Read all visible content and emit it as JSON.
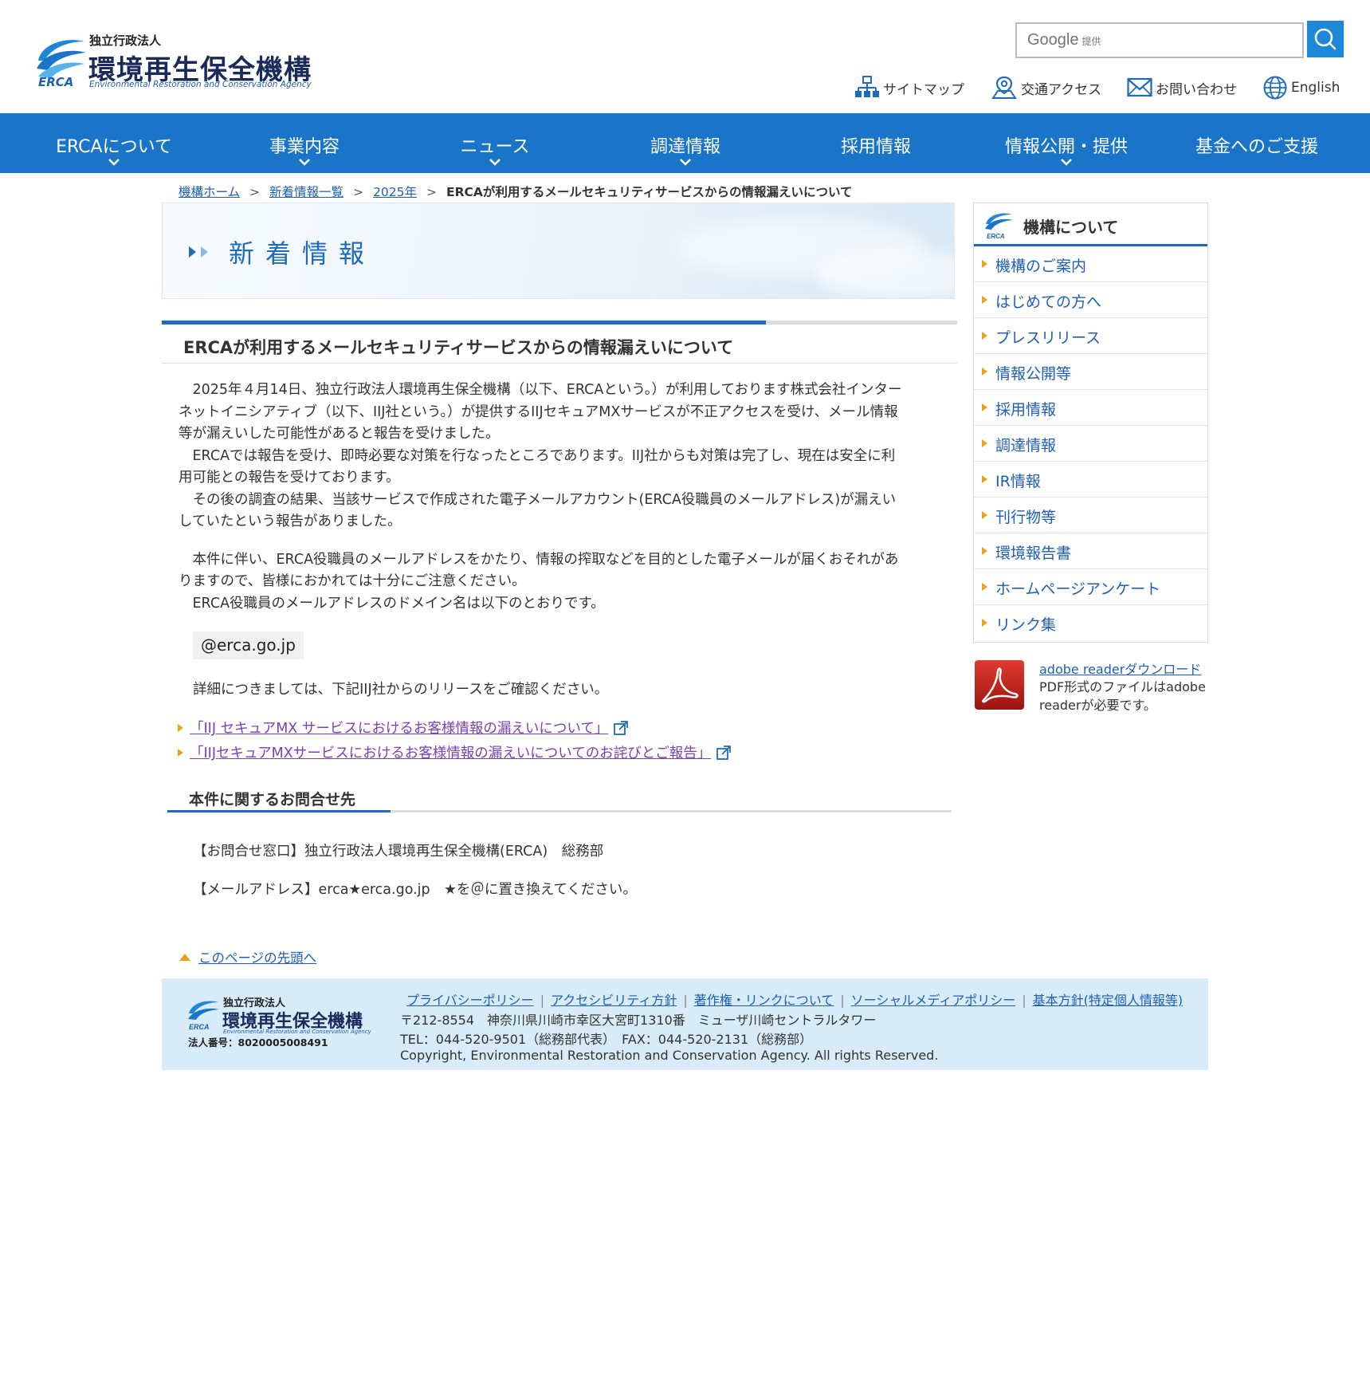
{
  "header": {
    "logo": {
      "small": "独立行政法人",
      "main": "環境再生保全機構",
      "en": "Environmental Restoration and Conservation Agency",
      "mark_text": "ERCA"
    },
    "search": {
      "brand": "Google",
      "brand_suffix": "提供",
      "placeholder": ""
    },
    "util_links": [
      {
        "label": "サイトマップ",
        "icon": "sitemap-icon"
      },
      {
        "label": "交通アクセス",
        "icon": "map-pin-icon"
      },
      {
        "label": "お問い合わせ",
        "icon": "mail-icon"
      },
      {
        "label": "English",
        "icon": "globe-icon"
      }
    ]
  },
  "nav": [
    {
      "label": "ERCAについて",
      "has_dropdown": true
    },
    {
      "label": "事業内容",
      "has_dropdown": true
    },
    {
      "label": "ニュース",
      "has_dropdown": true
    },
    {
      "label": "調達情報",
      "has_dropdown": true
    },
    {
      "label": "採用情報",
      "has_dropdown": false
    },
    {
      "label": "情報公開・提供",
      "has_dropdown": true
    },
    {
      "label": "基金へのご支援",
      "has_dropdown": false
    }
  ],
  "breadcrumb": {
    "items": [
      "機構ホーム",
      "新着情報一覧",
      "2025年"
    ],
    "separator": ">",
    "current": "ERCAが利用するメールセキュリティサービスからの情報漏えいについて"
  },
  "banner": {
    "title": "新着情報"
  },
  "article": {
    "title": "ERCAが利用するメールセキュリティサービスからの情報漏えいについて",
    "lines": [
      "　2025年４月14日、独立行政法人環境再生保全機構（以下、ERCAという。）が利用しております株式会社インター",
      "ネットイニシアティブ（以下、IIJ社という。）が提供するIIJセキュアMXサービスが不正アクセスを受け、メール情報",
      "等が漏えいした可能性があると報告を受けました。",
      "　ERCAでは報告を受け、即時必要な対策を行なったところであります。IIJ社からも対策は完了し、現在は安全に利",
      "用可能との報告を受けております。",
      "　その後の調査の結果、当該サービスで作成された電子メールアカウント(ERCA役職員のメールアドレス)が漏えい",
      "していたという報告がありました。"
    ],
    "lines2": [
      "　本件に伴い、ERCA役職員のメールアドレスをかたり、情報の搾取などを目的とした電子メールが届くおそれがあ",
      "りますので、皆様におかれては十分にご注意ください。",
      "　ERCA役職員のメールアドレスのドメイン名は以下のとおりです。"
    ],
    "domain": "@erca.go.jp",
    "details": "詳細につきましては、下記IIJ社からのリリースをご確認ください。",
    "links": [
      "「IIJ セキュアMX サービスにおけるお客様情報の漏えいについて」",
      "「IIJセキュアMXサービスにおけるお客様情報の漏えいについてのお詫びとご報告」"
    ]
  },
  "contact": {
    "title": "本件に関するお問合せ先",
    "window": "【お問合せ窓口】独立行政法人環境再生保全機構(ERCA)　総務部",
    "mail": "【メールアドレス】erca★erca.go.jp　★を＠に置き換えてください。"
  },
  "to_top": "このページの先頭へ",
  "sidebar": {
    "title": "機構について",
    "items": [
      "機構のご案内",
      "はじめての方へ",
      "プレスリリース",
      "情報公開等",
      "採用情報",
      "調達情報",
      "IR情報",
      "刊行物等",
      "環境報告書",
      "ホームページアンケート",
      "リンク集"
    ],
    "adobe": {
      "link": "adobe readerダウンロード",
      "note": "PDF形式のファイルはadobe readerが必要です。"
    }
  },
  "footer": {
    "logo": {
      "small": "独立行政法人",
      "main": "環境再生保全機構",
      "en": "Environmental Restoration and Conservation Agency",
      "corp_no": "法人番号：8020005008491",
      "mark_text": "ERCA"
    },
    "links": [
      "プライバシーポリシー",
      "アクセシビリティ方針",
      "著作権・リンクについて",
      "ソーシャルメディアポリシー",
      "基本方針(特定個人情報等)"
    ],
    "address": "〒212-8554　神奈川県川崎市幸区大宮町1310番　ミューザ川崎セントラルタワー",
    "tel": "TEL：044-520-9501（総務部代表）　FAX：044-520-2131（総務部）",
    "copyright": "Copyright, Environmental Restoration and Conservation Agency. All rights Reserved."
  },
  "colors": {
    "nav_bg": "#1a75c9",
    "accent_blue": "#1e6bb8",
    "link": "#1e5fb4",
    "visited_link": "#7b3fb0",
    "bullet": "#e8a317",
    "footer_bg": "#d7ecf8"
  }
}
